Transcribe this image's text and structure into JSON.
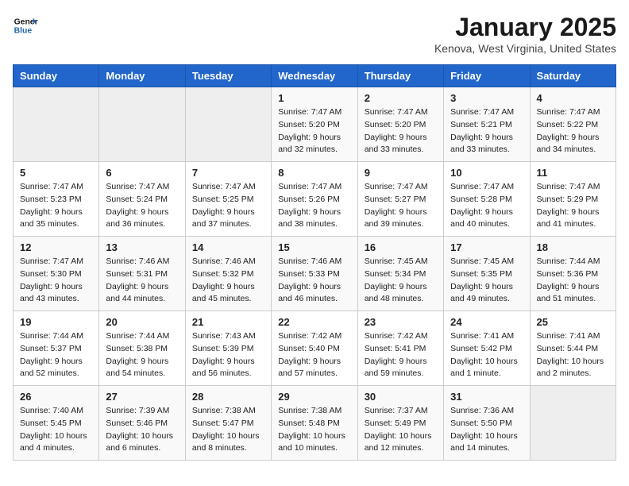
{
  "header": {
    "logo_general": "General",
    "logo_blue": "Blue",
    "month_title": "January 2025",
    "location": "Kenova, West Virginia, United States"
  },
  "weekdays": [
    "Sunday",
    "Monday",
    "Tuesday",
    "Wednesday",
    "Thursday",
    "Friday",
    "Saturday"
  ],
  "weeks": [
    [
      {
        "day": "",
        "sunrise": "",
        "sunset": "",
        "daylight": ""
      },
      {
        "day": "",
        "sunrise": "",
        "sunset": "",
        "daylight": ""
      },
      {
        "day": "",
        "sunrise": "",
        "sunset": "",
        "daylight": ""
      },
      {
        "day": "1",
        "sunrise": "Sunrise: 7:47 AM",
        "sunset": "Sunset: 5:20 PM",
        "daylight": "Daylight: 9 hours and 32 minutes."
      },
      {
        "day": "2",
        "sunrise": "Sunrise: 7:47 AM",
        "sunset": "Sunset: 5:20 PM",
        "daylight": "Daylight: 9 hours and 33 minutes."
      },
      {
        "day": "3",
        "sunrise": "Sunrise: 7:47 AM",
        "sunset": "Sunset: 5:21 PM",
        "daylight": "Daylight: 9 hours and 33 minutes."
      },
      {
        "day": "4",
        "sunrise": "Sunrise: 7:47 AM",
        "sunset": "Sunset: 5:22 PM",
        "daylight": "Daylight: 9 hours and 34 minutes."
      }
    ],
    [
      {
        "day": "5",
        "sunrise": "Sunrise: 7:47 AM",
        "sunset": "Sunset: 5:23 PM",
        "daylight": "Daylight: 9 hours and 35 minutes."
      },
      {
        "day": "6",
        "sunrise": "Sunrise: 7:47 AM",
        "sunset": "Sunset: 5:24 PM",
        "daylight": "Daylight: 9 hours and 36 minutes."
      },
      {
        "day": "7",
        "sunrise": "Sunrise: 7:47 AM",
        "sunset": "Sunset: 5:25 PM",
        "daylight": "Daylight: 9 hours and 37 minutes."
      },
      {
        "day": "8",
        "sunrise": "Sunrise: 7:47 AM",
        "sunset": "Sunset: 5:26 PM",
        "daylight": "Daylight: 9 hours and 38 minutes."
      },
      {
        "day": "9",
        "sunrise": "Sunrise: 7:47 AM",
        "sunset": "Sunset: 5:27 PM",
        "daylight": "Daylight: 9 hours and 39 minutes."
      },
      {
        "day": "10",
        "sunrise": "Sunrise: 7:47 AM",
        "sunset": "Sunset: 5:28 PM",
        "daylight": "Daylight: 9 hours and 40 minutes."
      },
      {
        "day": "11",
        "sunrise": "Sunrise: 7:47 AM",
        "sunset": "Sunset: 5:29 PM",
        "daylight": "Daylight: 9 hours and 41 minutes."
      }
    ],
    [
      {
        "day": "12",
        "sunrise": "Sunrise: 7:47 AM",
        "sunset": "Sunset: 5:30 PM",
        "daylight": "Daylight: 9 hours and 43 minutes."
      },
      {
        "day": "13",
        "sunrise": "Sunrise: 7:46 AM",
        "sunset": "Sunset: 5:31 PM",
        "daylight": "Daylight: 9 hours and 44 minutes."
      },
      {
        "day": "14",
        "sunrise": "Sunrise: 7:46 AM",
        "sunset": "Sunset: 5:32 PM",
        "daylight": "Daylight: 9 hours and 45 minutes."
      },
      {
        "day": "15",
        "sunrise": "Sunrise: 7:46 AM",
        "sunset": "Sunset: 5:33 PM",
        "daylight": "Daylight: 9 hours and 46 minutes."
      },
      {
        "day": "16",
        "sunrise": "Sunrise: 7:45 AM",
        "sunset": "Sunset: 5:34 PM",
        "daylight": "Daylight: 9 hours and 48 minutes."
      },
      {
        "day": "17",
        "sunrise": "Sunrise: 7:45 AM",
        "sunset": "Sunset: 5:35 PM",
        "daylight": "Daylight: 9 hours and 49 minutes."
      },
      {
        "day": "18",
        "sunrise": "Sunrise: 7:44 AM",
        "sunset": "Sunset: 5:36 PM",
        "daylight": "Daylight: 9 hours and 51 minutes."
      }
    ],
    [
      {
        "day": "19",
        "sunrise": "Sunrise: 7:44 AM",
        "sunset": "Sunset: 5:37 PM",
        "daylight": "Daylight: 9 hours and 52 minutes."
      },
      {
        "day": "20",
        "sunrise": "Sunrise: 7:44 AM",
        "sunset": "Sunset: 5:38 PM",
        "daylight": "Daylight: 9 hours and 54 minutes."
      },
      {
        "day": "21",
        "sunrise": "Sunrise: 7:43 AM",
        "sunset": "Sunset: 5:39 PM",
        "daylight": "Daylight: 9 hours and 56 minutes."
      },
      {
        "day": "22",
        "sunrise": "Sunrise: 7:42 AM",
        "sunset": "Sunset: 5:40 PM",
        "daylight": "Daylight: 9 hours and 57 minutes."
      },
      {
        "day": "23",
        "sunrise": "Sunrise: 7:42 AM",
        "sunset": "Sunset: 5:41 PM",
        "daylight": "Daylight: 9 hours and 59 minutes."
      },
      {
        "day": "24",
        "sunrise": "Sunrise: 7:41 AM",
        "sunset": "Sunset: 5:42 PM",
        "daylight": "Daylight: 10 hours and 1 minute."
      },
      {
        "day": "25",
        "sunrise": "Sunrise: 7:41 AM",
        "sunset": "Sunset: 5:44 PM",
        "daylight": "Daylight: 10 hours and 2 minutes."
      }
    ],
    [
      {
        "day": "26",
        "sunrise": "Sunrise: 7:40 AM",
        "sunset": "Sunset: 5:45 PM",
        "daylight": "Daylight: 10 hours and 4 minutes."
      },
      {
        "day": "27",
        "sunrise": "Sunrise: 7:39 AM",
        "sunset": "Sunset: 5:46 PM",
        "daylight": "Daylight: 10 hours and 6 minutes."
      },
      {
        "day": "28",
        "sunrise": "Sunrise: 7:38 AM",
        "sunset": "Sunset: 5:47 PM",
        "daylight": "Daylight: 10 hours and 8 minutes."
      },
      {
        "day": "29",
        "sunrise": "Sunrise: 7:38 AM",
        "sunset": "Sunset: 5:48 PM",
        "daylight": "Daylight: 10 hours and 10 minutes."
      },
      {
        "day": "30",
        "sunrise": "Sunrise: 7:37 AM",
        "sunset": "Sunset: 5:49 PM",
        "daylight": "Daylight: 10 hours and 12 minutes."
      },
      {
        "day": "31",
        "sunrise": "Sunrise: 7:36 AM",
        "sunset": "Sunset: 5:50 PM",
        "daylight": "Daylight: 10 hours and 14 minutes."
      },
      {
        "day": "",
        "sunrise": "",
        "sunset": "",
        "daylight": ""
      }
    ]
  ]
}
